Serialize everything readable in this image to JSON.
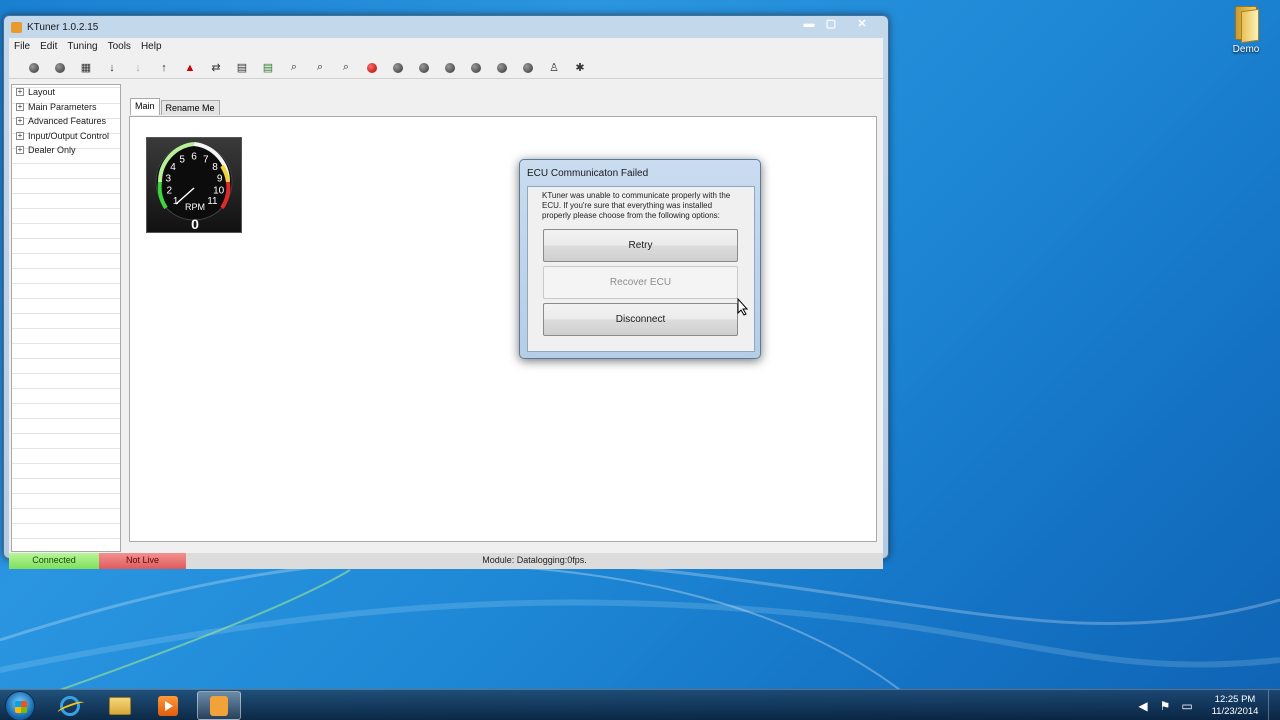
{
  "window": {
    "title": "KTuner 1.0.2.15",
    "min_glyph": "▬",
    "max_glyph": "▢",
    "close_glyph": "✕"
  },
  "menu": [
    "File",
    "Edit",
    "Tuning",
    "Tools",
    "Help"
  ],
  "toolbar": {
    "icons": [
      "connect-icon",
      "disconnect-icon",
      "chip-icon",
      "download-icon",
      "download-disabled-icon",
      "upload-icon",
      "warning-icon",
      "compare-icon",
      "datalog-icon",
      "save-log-icon",
      "zoom-icon",
      "zoom-in-icon",
      "zoom-out-icon",
      "record-icon",
      "play-icon",
      "pause-icon",
      "stop-icon",
      "rewind-icon",
      "forward-icon",
      "end-icon",
      "user-icon",
      "settings-icon"
    ]
  },
  "tree": {
    "items": [
      {
        "label": "Layout"
      },
      {
        "label": "Main Parameters"
      },
      {
        "label": "Advanced Features"
      },
      {
        "label": "Input/Output Control"
      },
      {
        "label": "Dealer Only"
      }
    ],
    "expand_glyph": "+"
  },
  "tabs": [
    {
      "label": "Main",
      "active": true
    },
    {
      "label": "Rename Me",
      "active": false
    }
  ],
  "gauge": {
    "label": "RPM",
    "value": "0",
    "ticks": [
      "1",
      "2",
      "3",
      "4",
      "5",
      "6",
      "7",
      "8",
      "9",
      "10",
      "11"
    ],
    "needle_value": 0
  },
  "status": {
    "connected": "Connected",
    "live": "Not Live",
    "info": "Module:  Datalogging:0fps."
  },
  "dialog": {
    "title": "ECU Communicaton Failed",
    "message": "KTuner was unable to communicate properly with the ECU. If you're sure that everything was installed properly please choose from the following options:",
    "retry": "Retry",
    "recover": "Recover ECU",
    "disconnect": "Disconnect"
  },
  "desktop": {
    "demo_label": "Demo"
  },
  "taskbar": {
    "time": "12:25 PM",
    "date": "11/23/2014",
    "apps": [
      "internet-explorer-icon",
      "windows-explorer-icon",
      "media-player-icon",
      "ktuner-icon"
    ]
  },
  "colors": {
    "connected": "#7ee05a",
    "not_live": "#e05a5a",
    "desktop": "#1e88d6"
  }
}
